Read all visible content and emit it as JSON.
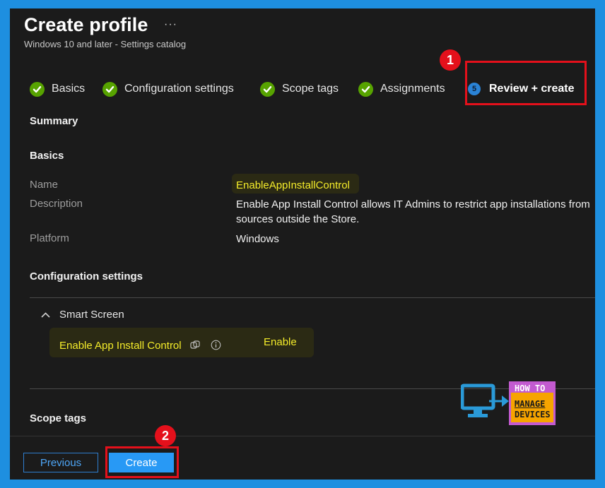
{
  "header": {
    "title": "Create profile",
    "more": "···",
    "subtitle": "Windows 10 and later - Settings catalog"
  },
  "steps": [
    {
      "label": "Basics",
      "state": "done"
    },
    {
      "label": "Configuration settings",
      "state": "done"
    },
    {
      "label": "Scope tags",
      "state": "done"
    },
    {
      "label": "Assignments",
      "state": "done"
    },
    {
      "label": "Review + create",
      "state": "active",
      "number": "5"
    }
  ],
  "callouts": [
    {
      "number": "1"
    },
    {
      "number": "2"
    }
  ],
  "summary": {
    "heading": "Summary",
    "basics_heading": "Basics",
    "fields": [
      {
        "label": "Name",
        "value": "EnableAppInstallControl"
      },
      {
        "label": "Description",
        "value_line1": "Enable App Install Control allows IT Admins to restrict app installations from",
        "value_line2": "sources outside the Store."
      },
      {
        "label": "Platform",
        "value": "Windows"
      }
    ],
    "config_heading": "Configuration settings",
    "group": {
      "name": "Smart Screen",
      "setting_label": "Enable App Install Control",
      "setting_value": "Enable"
    },
    "scope_heading": "Scope tags"
  },
  "footer": {
    "previous_label": "Previous",
    "create_label": "Create"
  },
  "logo": {
    "line1": "HOW TO",
    "line2": "MANAGE",
    "line3": "DEVICES"
  },
  "colors": {
    "accent": "#2899f5",
    "check": "#57a300",
    "callout": "#e4101b",
    "highlight_text": "#f4ec2a",
    "frame": "#1e8fe0"
  }
}
